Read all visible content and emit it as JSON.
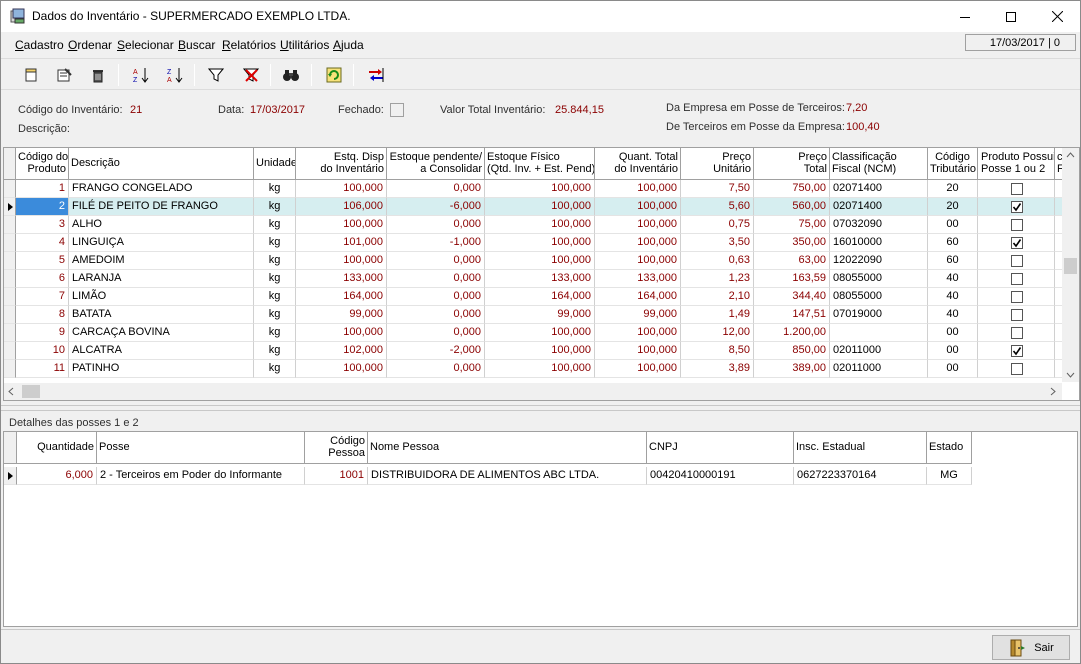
{
  "window": {
    "title": "Dados do Inventário - SUPERMERCADO EXEMPLO LTDA.",
    "date_box": "17/03/2017 | 0"
  },
  "menu": [
    {
      "underline": "C",
      "rest": "adastro"
    },
    {
      "underline": "O",
      "rest": "rdenar"
    },
    {
      "underline": "S",
      "rest": "elecionar"
    },
    {
      "underline": "B",
      "rest": "uscar"
    },
    {
      "underline": "R",
      "rest": "elatórios"
    },
    {
      "underline": "U",
      "rest": "tilitários"
    },
    {
      "underline": "A",
      "rest": "juda"
    }
  ],
  "header": {
    "codigo_label": "Código do Inventário:",
    "codigo_value": "21",
    "data_label": "Data:",
    "data_value": "17/03/2017",
    "fechado_label": "Fechado:",
    "valor_label": "Valor Total Inventário:",
    "valor_value": "25.844,15",
    "empresa_terceiros_label": "Da Empresa em Posse de Terceiros:",
    "empresa_terceiros_value": "7,20",
    "terceiros_empresa_label": "De Terceiros em Posse da Empresa:",
    "terceiros_empresa_value": "100,40",
    "descricao_label": "Descrição:"
  },
  "grid": {
    "columns": [
      [
        "Código do",
        "Produto"
      ],
      [
        "Descrição",
        ""
      ],
      [
        "Unidade",
        ""
      ],
      [
        "Estq. Disp",
        "do Inventário"
      ],
      [
        "Estoque pendente/",
        "a Consolidar"
      ],
      [
        "Estoque Físico",
        "(Qtd. Inv. + Est. Pend)"
      ],
      [
        "Quant. Total",
        "do Inventário"
      ],
      [
        "Preço",
        "Unitário"
      ],
      [
        "Preço",
        "Total"
      ],
      [
        "Classificação",
        "Fiscal (NCM)"
      ],
      [
        "Código",
        "Tributário"
      ],
      [
        "Produto Possui",
        "Posse 1 ou 2"
      ],
      [
        "c",
        "F"
      ]
    ],
    "rows": [
      {
        "cod": "1",
        "desc": "FRANGO CONGELADO",
        "un": "kg",
        "disp": "100,000",
        "pend": "0,000",
        "fis": "100,000",
        "tot": "100,000",
        "pu": "7,50",
        "pt": "750,00",
        "ncm": "02071400",
        "trib": "20",
        "posse": false
      },
      {
        "cod": "2",
        "desc": "FILÉ DE PEITO DE FRANGO",
        "un": "kg",
        "disp": "106,000",
        "pend": "-6,000",
        "fis": "100,000",
        "tot": "100,000",
        "pu": "5,60",
        "pt": "560,00",
        "ncm": "02071400",
        "trib": "20",
        "posse": true
      },
      {
        "cod": "3",
        "desc": "ALHO",
        "un": "kg",
        "disp": "100,000",
        "pend": "0,000",
        "fis": "100,000",
        "tot": "100,000",
        "pu": "0,75",
        "pt": "75,00",
        "ncm": "07032090",
        "trib": "00",
        "posse": false
      },
      {
        "cod": "4",
        "desc": "LINGUIÇA",
        "un": "kg",
        "disp": "101,000",
        "pend": "-1,000",
        "fis": "100,000",
        "tot": "100,000",
        "pu": "3,50",
        "pt": "350,00",
        "ncm": "16010000",
        "trib": "60",
        "posse": true
      },
      {
        "cod": "5",
        "desc": "AMEDOIM",
        "un": "kg",
        "disp": "100,000",
        "pend": "0,000",
        "fis": "100,000",
        "tot": "100,000",
        "pu": "0,63",
        "pt": "63,00",
        "ncm": "12022090",
        "trib": "60",
        "posse": false
      },
      {
        "cod": "6",
        "desc": "LARANJA",
        "un": "kg",
        "disp": "133,000",
        "pend": "0,000",
        "fis": "133,000",
        "tot": "133,000",
        "pu": "1,23",
        "pt": "163,59",
        "ncm": "08055000",
        "trib": "40",
        "posse": false
      },
      {
        "cod": "7",
        "desc": "LIMÃO",
        "un": "kg",
        "disp": "164,000",
        "pend": "0,000",
        "fis": "164,000",
        "tot": "164,000",
        "pu": "2,10",
        "pt": "344,40",
        "ncm": "08055000",
        "trib": "40",
        "posse": false
      },
      {
        "cod": "8",
        "desc": "BATATA",
        "un": "kg",
        "disp": "99,000",
        "pend": "0,000",
        "fis": "99,000",
        "tot": "99,000",
        "pu": "1,49",
        "pt": "147,51",
        "ncm": "07019000",
        "trib": "40",
        "posse": false
      },
      {
        "cod": "9",
        "desc": "CARCAÇA BOVINA",
        "un": "kg",
        "disp": "100,000",
        "pend": "0,000",
        "fis": "100,000",
        "tot": "100,000",
        "pu": "12,00",
        "pt": "1.200,00",
        "ncm": "",
        "trib": "00",
        "posse": false
      },
      {
        "cod": "10",
        "desc": "ALCATRA",
        "un": "kg",
        "disp": "102,000",
        "pend": "-2,000",
        "fis": "100,000",
        "tot": "100,000",
        "pu": "8,50",
        "pt": "850,00",
        "ncm": "02011000",
        "trib": "00",
        "posse": true
      },
      {
        "cod": "11",
        "desc": "PATINHO",
        "un": "kg",
        "disp": "100,000",
        "pend": "0,000",
        "fis": "100,000",
        "tot": "100,000",
        "pu": "3,89",
        "pt": "389,00",
        "ncm": "02011000",
        "trib": "00",
        "posse": false
      }
    ]
  },
  "details": {
    "title": "Detalhes das posses 1 e 2",
    "columns": [
      [
        "",
        "Quantidade"
      ],
      [
        "",
        "Posse"
      ],
      [
        "Código",
        "Pessoa"
      ],
      [
        "",
        "Nome Pessoa"
      ],
      [
        "",
        "CNPJ"
      ],
      [
        "",
        "Insc. Estadual"
      ],
      [
        "",
        "Estado"
      ]
    ],
    "rows": [
      {
        "qtd": "6,000",
        "posse": "2 - Terceiros em Poder do Informante",
        "cod": "1001",
        "nome": "DISTRIBUIDORA DE ALIMENTOS ABC LTDA.",
        "cnpj": "00420410000191",
        "ie": "0627223370164",
        "uf": "MG"
      }
    ]
  },
  "footer": {
    "sair_label": "Sair"
  }
}
